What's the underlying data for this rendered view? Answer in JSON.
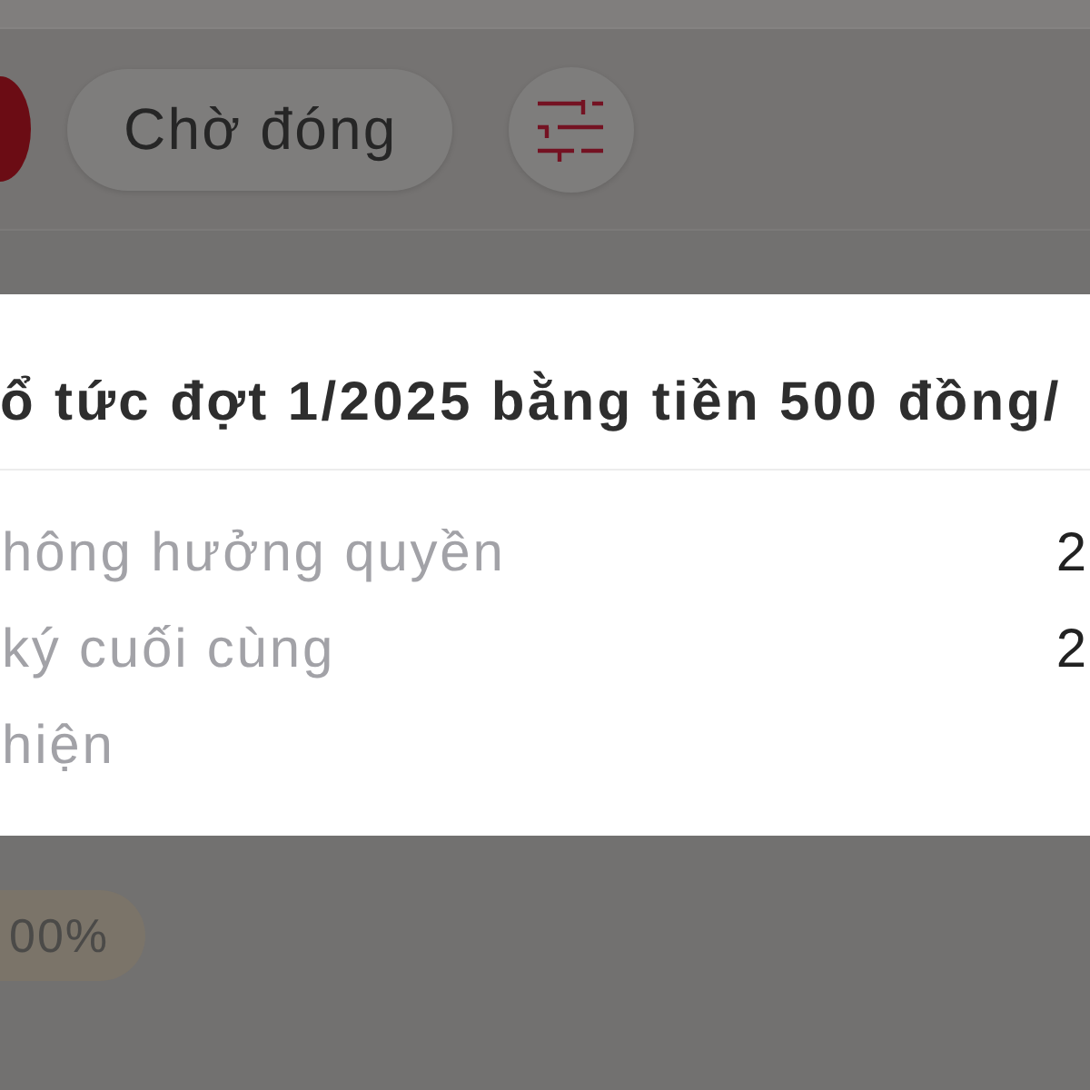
{
  "filter_bar": {
    "chips": [
      {
        "selected": true
      },
      {
        "label": "Chờ đóng",
        "selected": false
      }
    ]
  },
  "dialog": {
    "title": "ổ tức đợt 1/2025 bằng tiền 500 đồng/",
    "rows": [
      {
        "label": "hông hưởng quyền",
        "value": "2"
      },
      {
        "label": "ký cuối cùng",
        "value": "2"
      },
      {
        "label": "hiện"
      }
    ]
  },
  "list": {
    "badge": "00%"
  }
}
